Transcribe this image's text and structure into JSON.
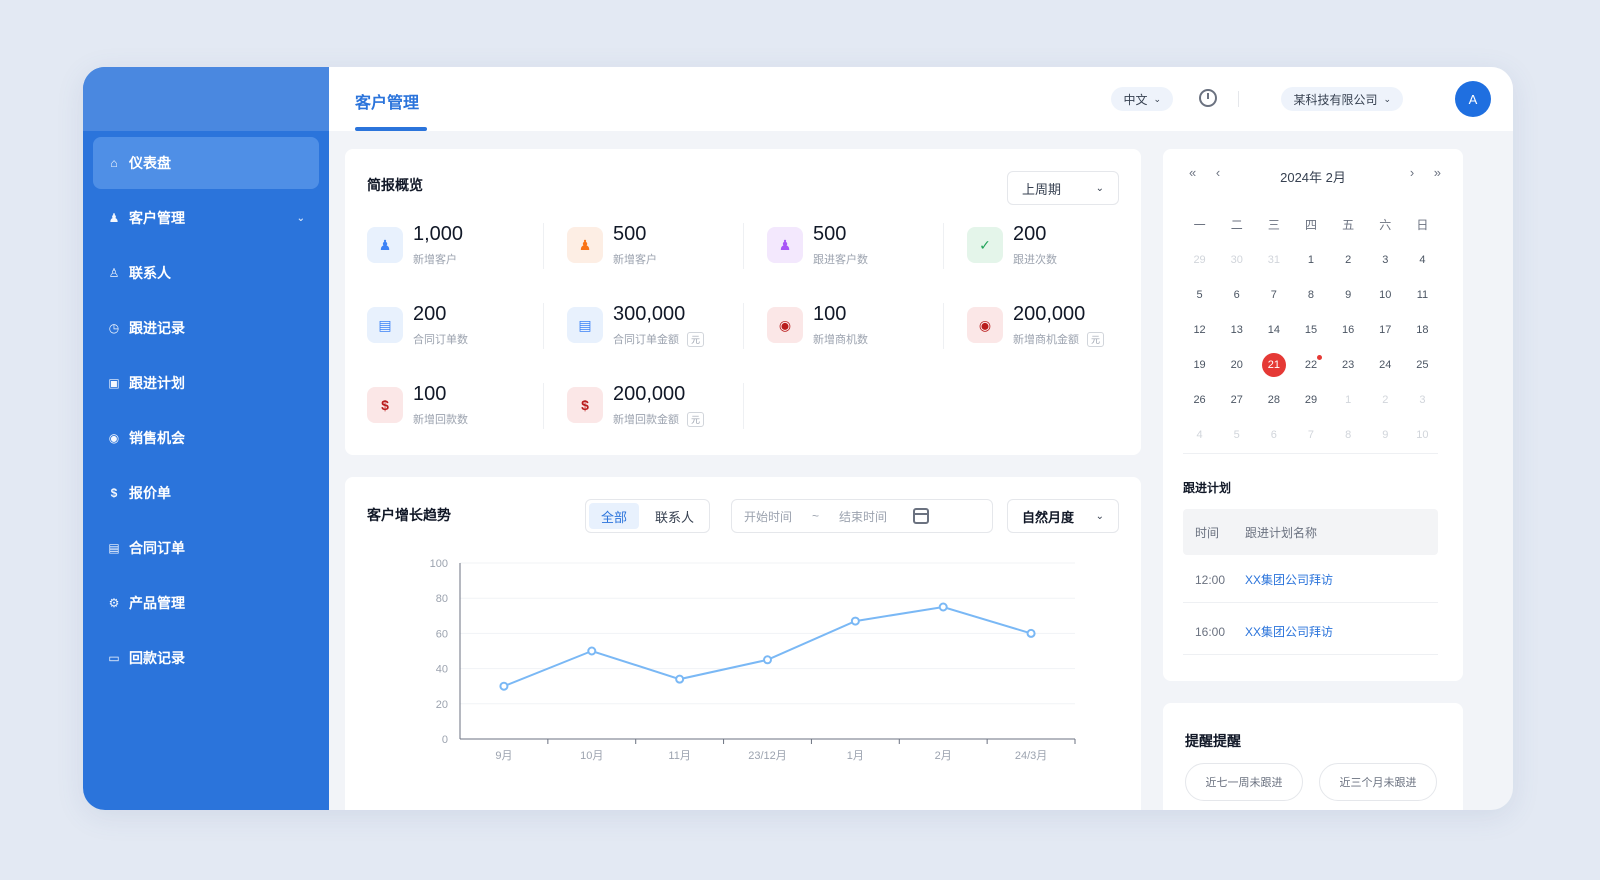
{
  "sidebar": {
    "items": [
      {
        "label": "仪表盘",
        "icon": "dashboard-icon",
        "glyph": "⌂",
        "active": true
      },
      {
        "label": "客户管理",
        "icon": "customers-icon",
        "glyph": "♟",
        "expandable": true
      },
      {
        "label": "联系人",
        "icon": "contact-icon",
        "glyph": "♙"
      },
      {
        "label": "跟进记录",
        "icon": "followup-icon",
        "glyph": "◷"
      },
      {
        "label": "跟进计划",
        "icon": "plan-icon",
        "glyph": "▣"
      },
      {
        "label": "销售机会",
        "icon": "opportunity-icon",
        "glyph": "◉"
      },
      {
        "label": "报价单",
        "icon": "dollar-icon",
        "glyph": "$"
      },
      {
        "label": "合同订单",
        "icon": "contract-icon",
        "glyph": "▤"
      },
      {
        "label": "产品管理",
        "icon": "product-icon",
        "glyph": "⚙"
      },
      {
        "label": "回款记录",
        "icon": "payment-icon",
        "glyph": "▭"
      }
    ]
  },
  "topbar": {
    "tab_title": "客户管理",
    "language": "中文",
    "company": "某科技有限公司",
    "avatar_text": "A"
  },
  "overview": {
    "title": "简报概览",
    "period": "上周期",
    "stats": [
      {
        "value": "1,000",
        "label": "新增客户",
        "color": "#3b82f6",
        "bg": "#e8f1fd",
        "glyph": "♟"
      },
      {
        "value": "500",
        "label": "新增客户",
        "color": "#f97316",
        "bg": "#fdeee4",
        "glyph": "♟"
      },
      {
        "value": "500",
        "label": "跟进客户数",
        "color": "#a855f7",
        "bg": "#f3e8fd",
        "glyph": "♟"
      },
      {
        "value": "200",
        "label": "跟进次数",
        "color": "#22a35a",
        "bg": "#e4f5ea",
        "glyph": "✓"
      },
      {
        "value": "200",
        "label": "合同订单数",
        "color": "#3b82f6",
        "bg": "#e8f1fd",
        "glyph": "▤"
      },
      {
        "value": "300,000",
        "label": "合同订单金额",
        "unit": "元",
        "color": "#3b82f6",
        "bg": "#e8f1fd",
        "glyph": "▤"
      },
      {
        "value": "100",
        "label": "新增商机数",
        "color": "#b91c1c",
        "bg": "#fbe7e7",
        "glyph": "◉"
      },
      {
        "value": "200,000",
        "label": "新增商机金额",
        "unit": "元",
        "color": "#b91c1c",
        "bg": "#fbe7e7",
        "glyph": "◉"
      },
      {
        "value": "100",
        "label": "新增回款数",
        "color": "#b91c1c",
        "bg": "#fbe7e7",
        "glyph": "$"
      },
      {
        "value": "200,000",
        "label": "新增回款金额",
        "unit": "元",
        "color": "#b91c1c",
        "bg": "#fbe7e7",
        "glyph": "$"
      }
    ]
  },
  "trend": {
    "title": "客户增长趋势",
    "toggle": [
      "全部",
      "联系人"
    ],
    "start_placeholder": "开始时间",
    "range_sep": "~",
    "end_placeholder": "结束时间",
    "range": "自然月度"
  },
  "chart_data": {
    "type": "line",
    "categories": [
      "9月",
      "10月",
      "11月",
      "23/12月",
      "1月",
      "2月",
      "24/3月"
    ],
    "values": [
      30,
      50,
      34,
      45,
      67,
      75,
      60
    ],
    "ylim": [
      0,
      100
    ],
    "yticks": [
      "100",
      "80",
      "60",
      "40",
      "20",
      "0"
    ],
    "color": "#7ab8f5"
  },
  "calendar": {
    "title": "2024年 2月",
    "nav_prev": "« ‹",
    "nav_next": "› »",
    "weekdays": [
      "一",
      "二",
      "三",
      "四",
      "五",
      "六",
      "日"
    ],
    "days": [
      [
        "29",
        "30",
        "31",
        "1",
        "2",
        "3",
        "4"
      ],
      [
        "5",
        "6",
        "7",
        "8",
        "9",
        "10",
        "11"
      ],
      [
        "12",
        "13",
        "14",
        "15",
        "16",
        "17",
        "18"
      ],
      [
        "19",
        "20",
        "21",
        "22",
        "23",
        "24",
        "25"
      ],
      [
        "26",
        "27",
        "28",
        "29",
        "1",
        "2",
        "3"
      ],
      [
        "4",
        "5",
        "6",
        "7",
        "8",
        "9",
        "10"
      ]
    ],
    "today": "21",
    "marked": "22"
  },
  "plans": {
    "title": "跟进计划",
    "header_time": "时间",
    "header_content": "跟进计划名称",
    "items": [
      {
        "time": "12:00",
        "name": "XX集团公司拜访"
      },
      {
        "time": "16:00",
        "name": "XX集团公司拜访"
      }
    ]
  },
  "reminder": {
    "title": "提醒提醒",
    "buttons": [
      "近七一周未跟进",
      "近三个月未跟进"
    ]
  }
}
